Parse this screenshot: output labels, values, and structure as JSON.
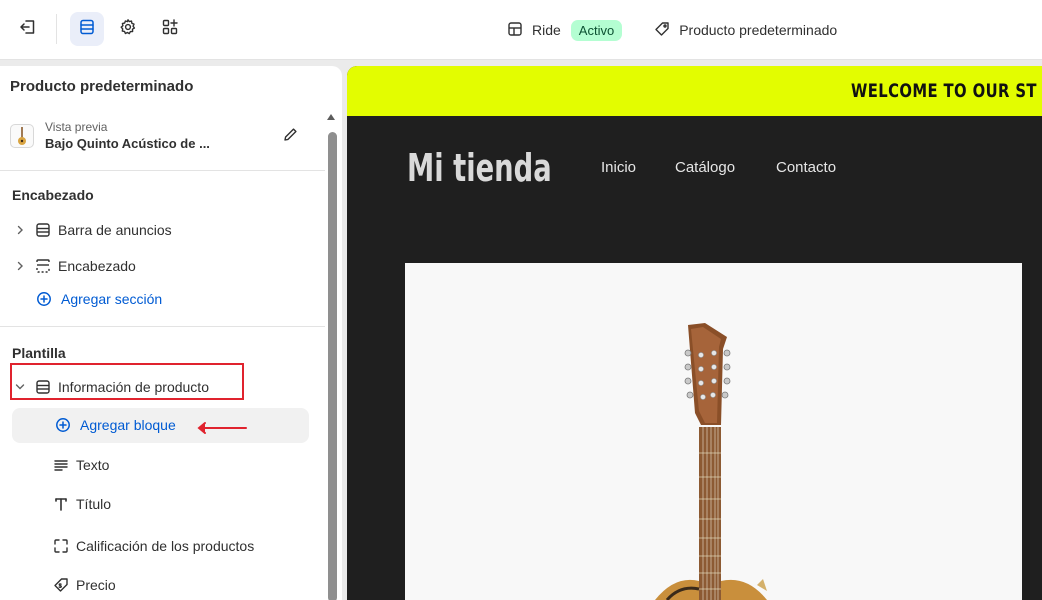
{
  "toolbar": {
    "exit_icon": "exit-icon",
    "sections_icon": "sections-icon",
    "settings_icon": "gear-icon",
    "apps_icon": "apps-icon",
    "theme_name": "Ride",
    "status_badge": "Activo",
    "template_name": "Producto predeterminado"
  },
  "sidebar": {
    "title": "Producto predeterminado",
    "preview_label": "Vista previa",
    "preview_product": "Bajo Quinto Acústico de ...",
    "header_group": {
      "heading": "Encabezado",
      "items": [
        {
          "label": "Barra de anuncios",
          "icon": "section-icon"
        },
        {
          "label": "Encabezado",
          "icon": "header-icon"
        }
      ],
      "add_section": "Agregar sección"
    },
    "template_group": {
      "heading": "Plantilla",
      "section": "Información de producto",
      "add_block": "Agregar bloque",
      "blocks": [
        {
          "label": "Texto",
          "icon": "text-icon"
        },
        {
          "label": "Título",
          "icon": "title-icon"
        },
        {
          "label": "Calificación de los productos",
          "icon": "rating-icon"
        },
        {
          "label": "Precio",
          "icon": "price-tag-icon"
        }
      ]
    }
  },
  "storefront": {
    "announcement": "WELCOME TO OUR ST",
    "store_name": "Mi tienda",
    "nav": [
      "Inicio",
      "Catálogo",
      "Contacto"
    ]
  },
  "colors": {
    "accent": "#005bd3",
    "announcement_bg": "#e3fd00",
    "store_bg": "#1f1f1f",
    "highlight": "#e0232e",
    "badge_bg": "#b4fed2"
  }
}
